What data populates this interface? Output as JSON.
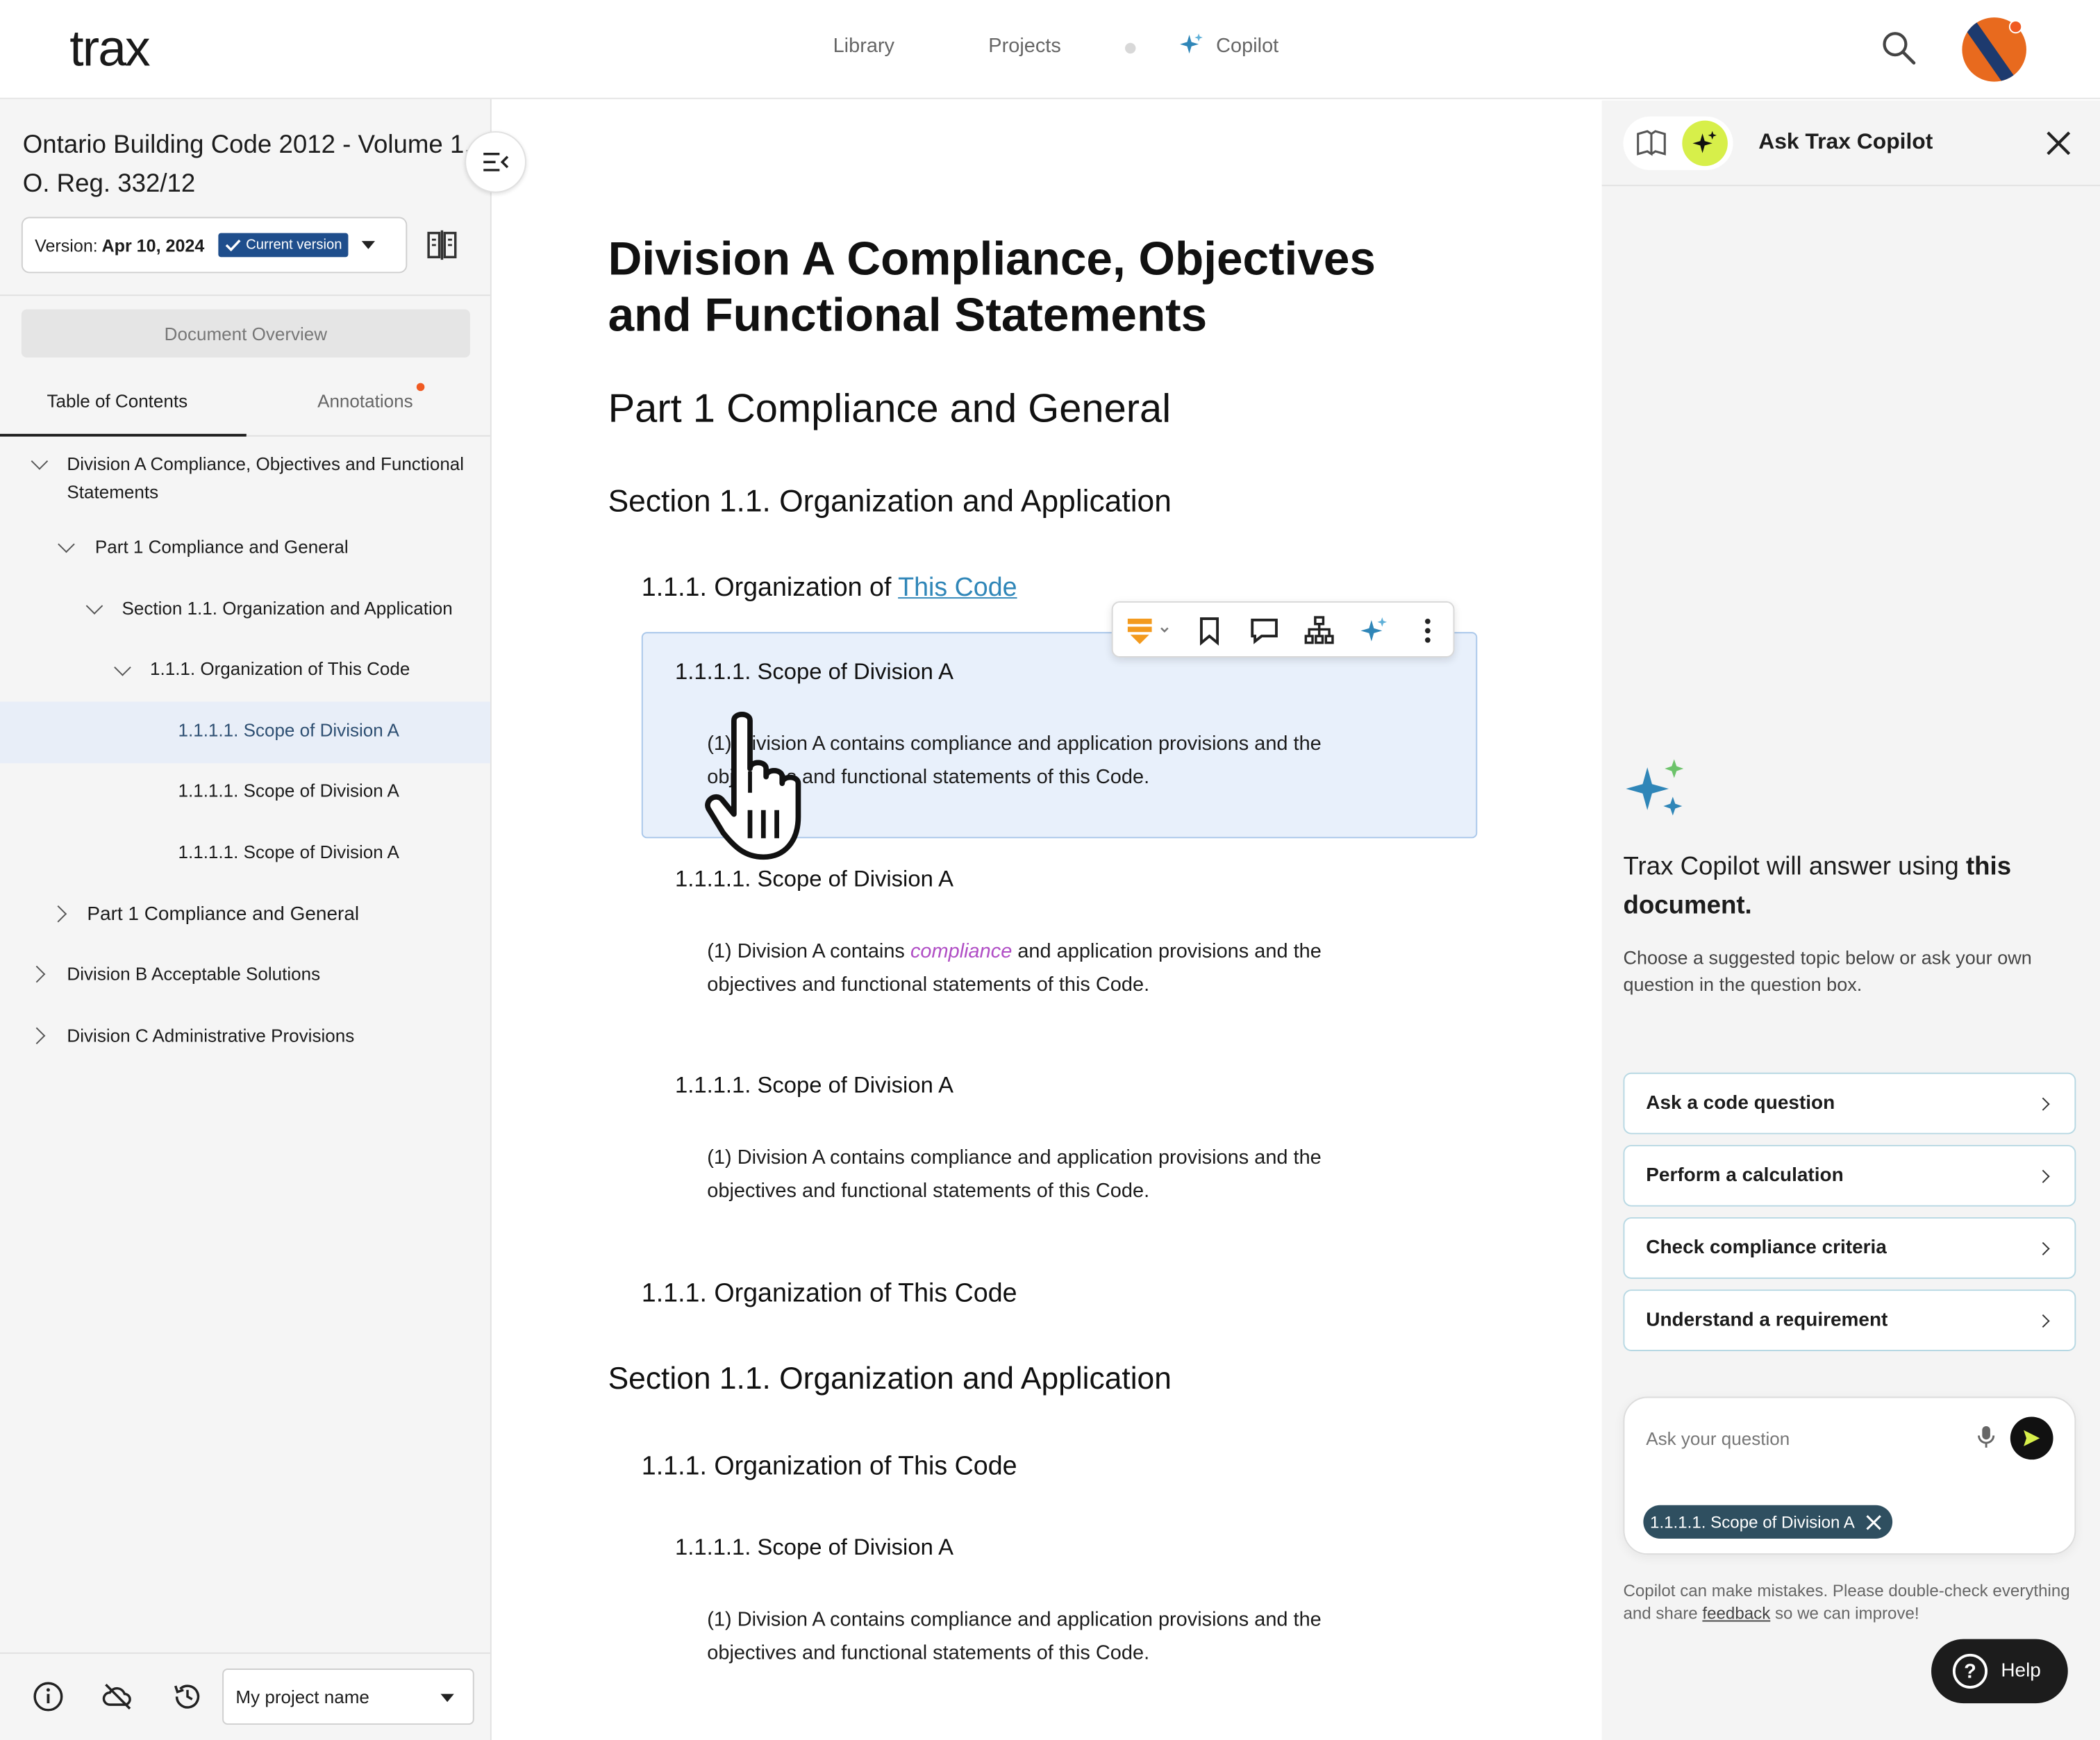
{
  "brand": {
    "logo": "trax"
  },
  "topnav": {
    "library": "Library",
    "projects": "Projects",
    "copilot": "Copilot",
    "avatar_color": "#e86a1e"
  },
  "sidebar": {
    "doc_title": "Ontario Building Code 2012 - Volume 1, O. Reg. 332/12",
    "version_label": "Version:",
    "version_date": "Apr 10, 2024",
    "current_badge": "Current version",
    "overview_button": "Document Overview",
    "tabs": {
      "toc": "Table of Contents",
      "annotations": "Annotations"
    },
    "toc": [
      {
        "label": "Division A Compliance, Objectives and Functional Statements",
        "state": "expanded"
      },
      {
        "label": "Part 1 Compliance and General",
        "state": "expanded"
      },
      {
        "label": "Section 1.1. Organization and Application",
        "state": "expanded"
      },
      {
        "label": "1.1.1. Organization of This Code",
        "state": "expanded"
      },
      {
        "label": "1.1.1.1. Scope of Division A",
        "state": "active"
      },
      {
        "label": "1.1.1.1. Scope of Division A",
        "state": "leaf"
      },
      {
        "label": "1.1.1.1. Scope of Division A",
        "state": "leaf"
      },
      {
        "label": "Part 1 Compliance and General",
        "state": "collapsed"
      },
      {
        "label": "Division B Acceptable Solutions",
        "state": "collapsed"
      },
      {
        "label": "Division C Administrative Provisions",
        "state": "collapsed"
      }
    ],
    "project_select": "My project name",
    "active_color": "#e8eef8"
  },
  "document": {
    "division_title": "Division A Compliance, Objectives and Functional Statements",
    "part_title": "Part 1 Compliance and General",
    "section_title": "Section 1.1. Organization and Application",
    "article_prefix": "1.1.1. Organization of ",
    "article_link": "This Code",
    "sentence_title": "1.1.1.1. Scope of Division A",
    "para_selected": "(1) Division A contains compliance and application provisions and the objectives and functional statements of this Code.",
    "para_2_pre": "(1) Division A contains ",
    "para_2_term": "compliance",
    "para_2_post": " and application provisions and the objectives and functional statements of this Code.",
    "para_3": "(1) Division A contains compliance and application provisions and the objectives and functional statements of this Code.",
    "article_2": "1.1.1. Organization of This Code",
    "section_2": "Section 1.1. Organization and Application",
    "article_3": "1.1.1. Organization of This Code",
    "sentence_4": "1.1.1.1. Scope of Division A",
    "para_4": "(1) Division A contains compliance and application provisions and the objectives and functional statements of this Code.",
    "link_color": "#2f86b8",
    "highlight_term_color": "#b04ec5",
    "selection_color": "#e8f0fb"
  },
  "copilot": {
    "title": "Ask Trax Copilot",
    "intro_pre": "Trax Copilot will answer using ",
    "intro_bold": "this document.",
    "sub": "Choose a suggested topic below or ask your own question in the question box.",
    "suggestions": [
      "Ask a code question",
      "Perform a calculation",
      "Check compliance criteria",
      "Understand a requirement"
    ],
    "ask_placeholder": "Ask your question",
    "context_chip": "1.1.1.1. Scope of Division A",
    "disclaimer_pre": "Copilot can make mistakes. Please double-check everything and share ",
    "disclaimer_link": "feedback",
    "disclaimer_post": " so we can improve!",
    "help": "Help",
    "accent_color": "#d7ef4a",
    "chip_color": "#2f4f60"
  }
}
